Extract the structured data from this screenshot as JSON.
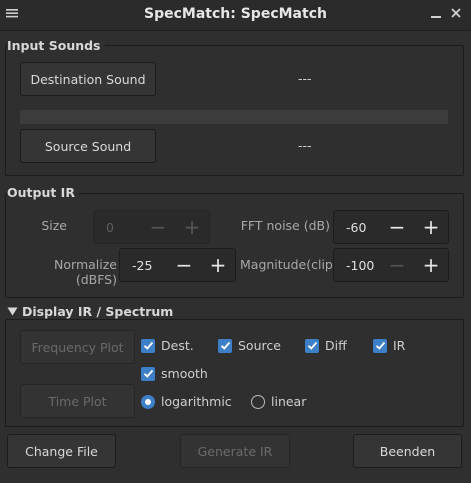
{
  "window": {
    "title": "SpecMatch: SpecMatch"
  },
  "input_sounds": {
    "label": "Input Sounds",
    "destination_button": "Destination Sound",
    "destination_value": "---",
    "source_button": "Source Sound",
    "source_value": "---"
  },
  "output_ir": {
    "label": "Output IR",
    "size_label": "Size",
    "size_value": "0",
    "fft_noise_label": "FFT noise (dB)",
    "fft_noise_value": "-60",
    "normalize_label": "Normalize (dBFS)",
    "normalize_value": "-25",
    "magnitude_label": "Magnitude(clip)",
    "magnitude_value": "-100"
  },
  "display": {
    "label": "Display IR / Spectrum",
    "frequency_plot_button": "Frequency Plot",
    "time_plot_button": "Time Plot",
    "checkboxes": {
      "dest": "Dest.",
      "source": "Source",
      "diff": "Diff",
      "ir": "IR",
      "smooth": "smooth"
    },
    "radio_logarithmic": "logarithmic",
    "radio_linear": "linear"
  },
  "footer": {
    "change_file": "Change File",
    "generate_ir": "Generate IR",
    "beenden": "Beenden"
  },
  "icons": {
    "minimize": "minimize-icon",
    "close": "close-icon",
    "collapse": "triangle-down-icon"
  },
  "colors": {
    "accent": "#3d80c8",
    "background": "#2f2f2f"
  }
}
